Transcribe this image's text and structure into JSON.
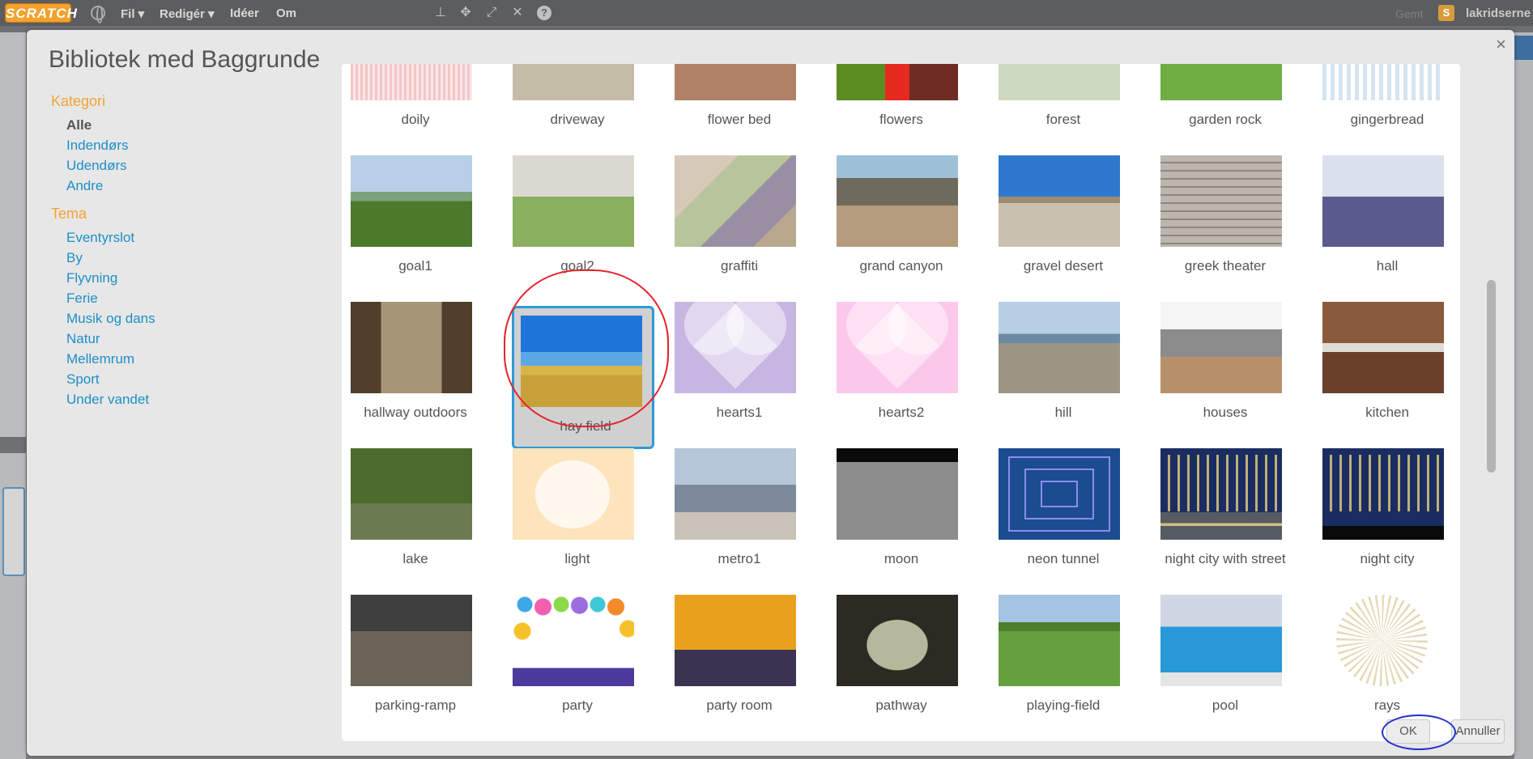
{
  "menubar": {
    "logo": "SCRATCH",
    "menus": [
      "Fil ▾",
      "Redigér ▾",
      "Idéer",
      "Om"
    ],
    "tools": [
      "stamp-icon",
      "move-icon",
      "grow-icon",
      "shrink-icon",
      "help-icon"
    ],
    "save_status": "Gemt",
    "username": "lakridserne"
  },
  "dialog": {
    "title": "Bibliotek med Baggrunde",
    "close": "×",
    "category_heading": "Kategori",
    "categories": [
      "Alle",
      "Indendørs",
      "Udendørs",
      "Andre"
    ],
    "active_category": "Alle",
    "theme_heading": "Tema",
    "themes": [
      "Eventyrslot",
      "By",
      "Flyvning",
      "Ferie",
      "Musik og dans",
      "Natur",
      "Mellemrum",
      "Sport",
      "Under vandet"
    ],
    "ok_label": "OK",
    "cancel_label": "Annuller"
  },
  "gallery": {
    "selected": "hay field",
    "items": [
      "doily",
      "driveway",
      "flower bed",
      "flowers",
      "forest",
      "garden rock",
      "gingerbread",
      "goal1",
      "goal2",
      "graffiti",
      "grand canyon",
      "gravel desert",
      "greek theater",
      "hall",
      "hallway outdoors",
      "hay field",
      "hearts1",
      "hearts2",
      "hill",
      "houses",
      "kitchen",
      "lake",
      "light",
      "metro1",
      "moon",
      "neon tunnel",
      "night city with street",
      "night city",
      "parking-ramp",
      "party",
      "party room",
      "pathway",
      "playing-field",
      "pool",
      "rays"
    ]
  },
  "colors": {
    "accent_orange": "#f3a331",
    "link_blue": "#1c8fc7",
    "selection_border": "#2e9ad7",
    "annotation_red": "#e5232c",
    "annotation_blue": "#2430c9"
  }
}
